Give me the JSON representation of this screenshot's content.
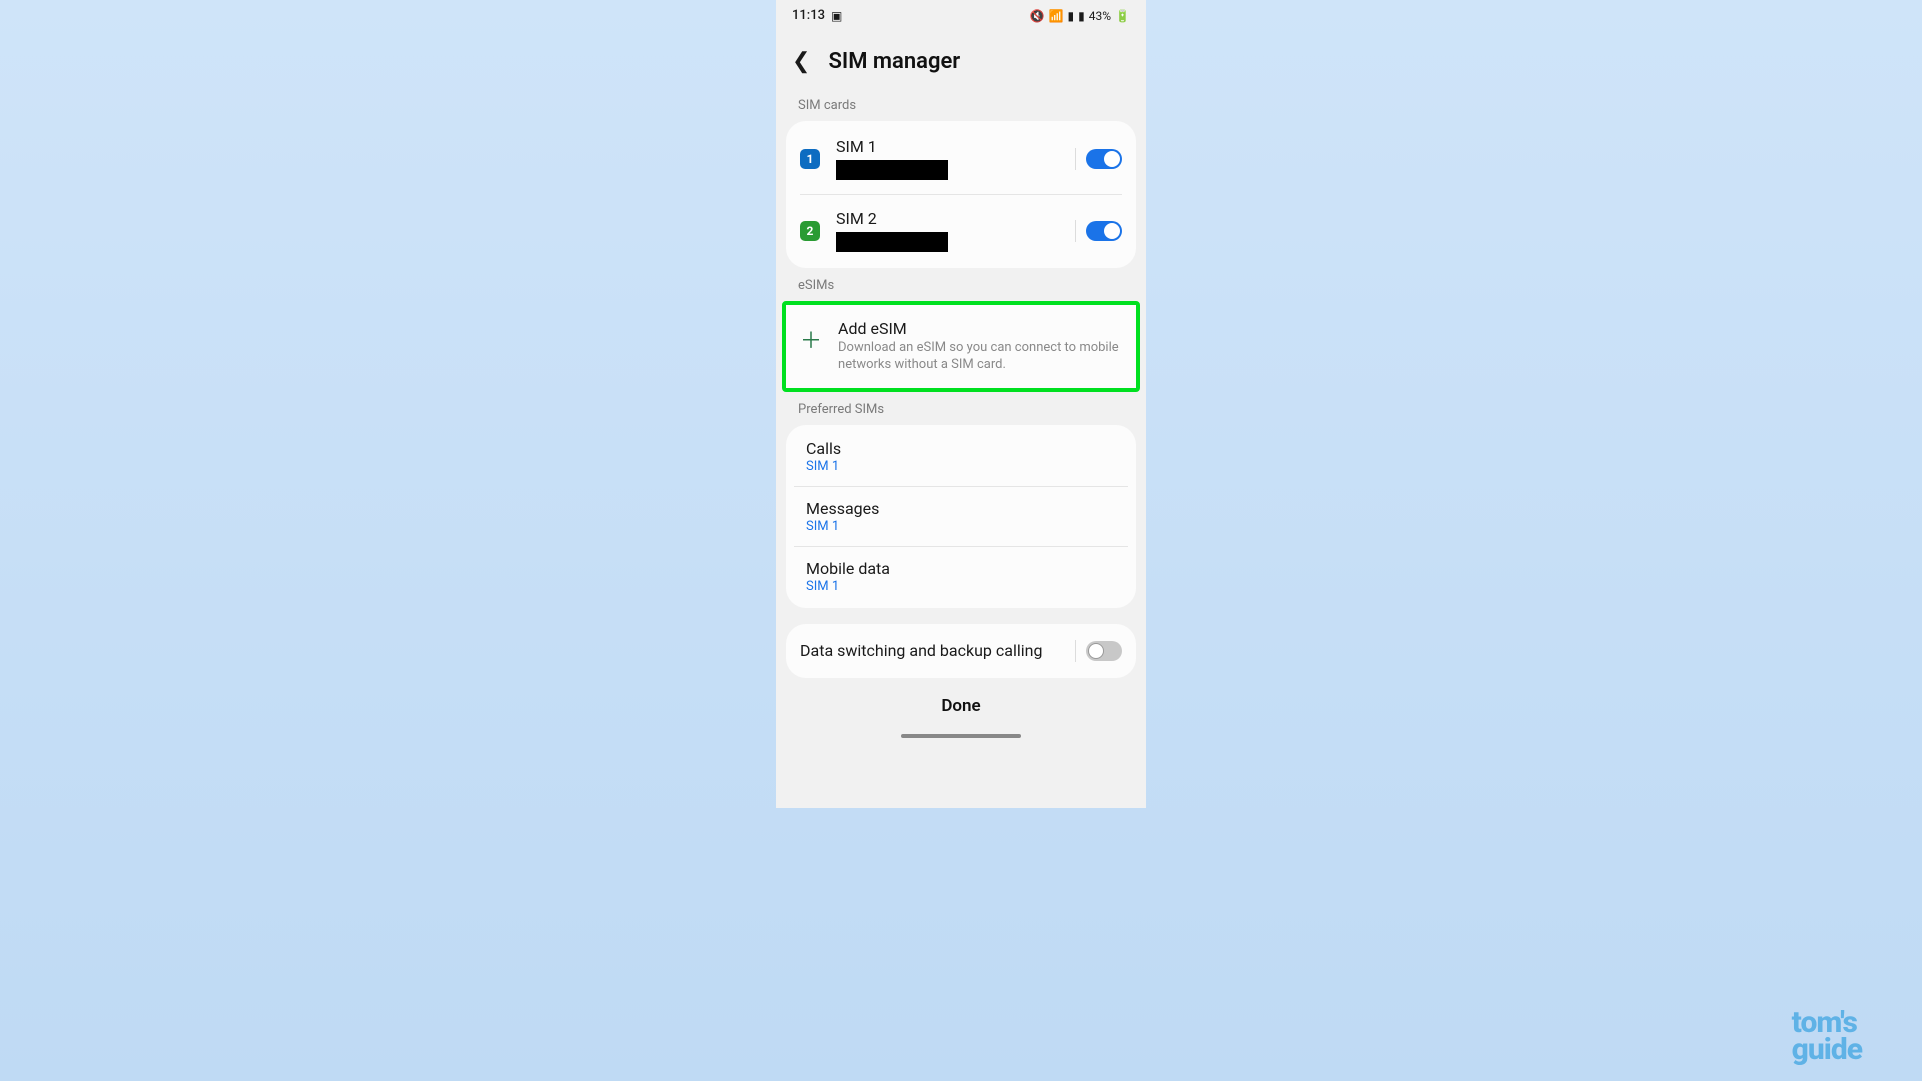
{
  "status": {
    "time": "11:13",
    "battery": "43%"
  },
  "header": {
    "title": "SIM manager"
  },
  "sections": {
    "simcards_label": "SIM cards",
    "esims_label": "eSIMs",
    "preferred_label": "Preferred SIMs"
  },
  "sim1": {
    "badge": "1",
    "name": "SIM 1",
    "enabled": true
  },
  "sim2": {
    "badge": "2",
    "name": "SIM 2",
    "enabled": true
  },
  "esim": {
    "title": "Add eSIM",
    "desc": "Download an eSIM so you can connect to mobile networks without a SIM card."
  },
  "preferred": {
    "calls": {
      "label": "Calls",
      "value": "SIM 1"
    },
    "messages": {
      "label": "Messages",
      "value": "SIM 1"
    },
    "data": {
      "label": "Mobile data",
      "value": "SIM 1"
    }
  },
  "data_switching": {
    "label": "Data switching and backup calling",
    "enabled": false
  },
  "done": "Done",
  "watermark": {
    "line1": "tom's",
    "line2": "guide"
  }
}
